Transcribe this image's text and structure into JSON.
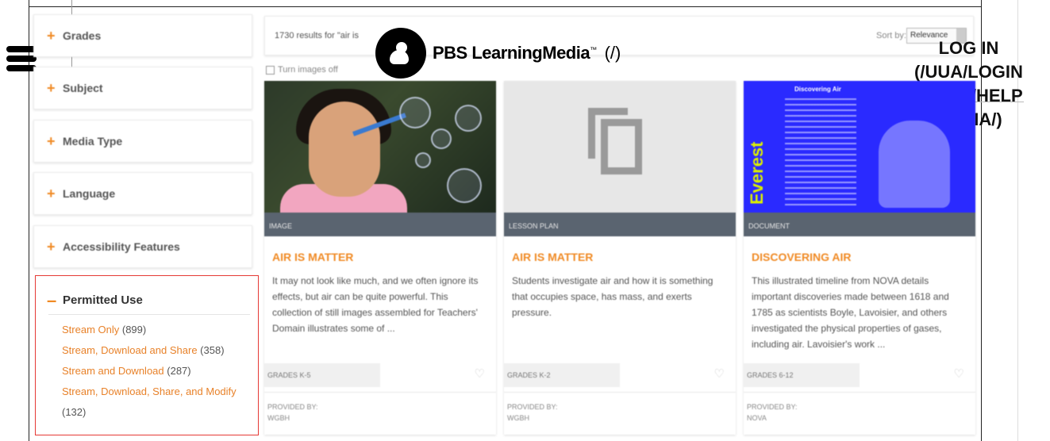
{
  "header": {
    "logo_text": "PBS LearningMedia",
    "logo_tm": "™",
    "logo_link": "(/)",
    "login_lines": [
      "LOG IN",
      "(/UUA/LOGIN",
      "NEXT=/HELP",
      "MEDIA/)"
    ]
  },
  "filters": {
    "facets": [
      "Grades",
      "Subject",
      "Media Type",
      "Language",
      "Accessibility Features"
    ],
    "permitted_use": {
      "title": "Permitted Use",
      "options": [
        {
          "label": "Stream Only",
          "count": "(899)"
        },
        {
          "label": "Stream, Download and Share",
          "count": "(358)"
        },
        {
          "label": "Stream and Download",
          "count": "(287)"
        },
        {
          "label": "Stream, Download, Share, and Modify",
          "count": "(132)"
        }
      ]
    }
  },
  "results": {
    "count_text": "1730 results for \"air is",
    "sort_label": "Sort by:",
    "sort_value": "Relevance",
    "images_toggle": "Turn images off"
  },
  "cards": [
    {
      "type": "IMAGE",
      "title": "AIR IS MATTER",
      "description": "It may not look like much, and we often ignore its effects, but air can be quite powerful. This collection of still images assembled for Teachers' Domain illustrates some of ...",
      "grades": "GRADES K-5",
      "provided_label": "PROVIDED BY:",
      "provider": "WGBH"
    },
    {
      "type": "LESSON PLAN",
      "title": "AIR IS MATTER",
      "description": "Students investigate air and how it is something that occupies space, has mass, and exerts pressure.",
      "grades": "GRADES K-2",
      "provided_label": "PROVIDED BY:",
      "provider": "WGBH"
    },
    {
      "type": "DOCUMENT",
      "title": "DISCOVERING AIR",
      "description": "This illustrated timeline from NOVA details important discoveries made between 1618 and 1785 as scientists Boyle, Lavoisier, and others investigated the physical properties of gases, including air. Lavoisier's work ...",
      "grades": "GRADES 6-12",
      "provided_label": "PROVIDED BY:",
      "provider": "NOVA",
      "thumb_heading": "Discovering Air",
      "thumb_word": "Everest"
    }
  ],
  "colors": {
    "accent": "#f08a24",
    "highlight_border": "#e53935",
    "band": "#5a6470"
  }
}
